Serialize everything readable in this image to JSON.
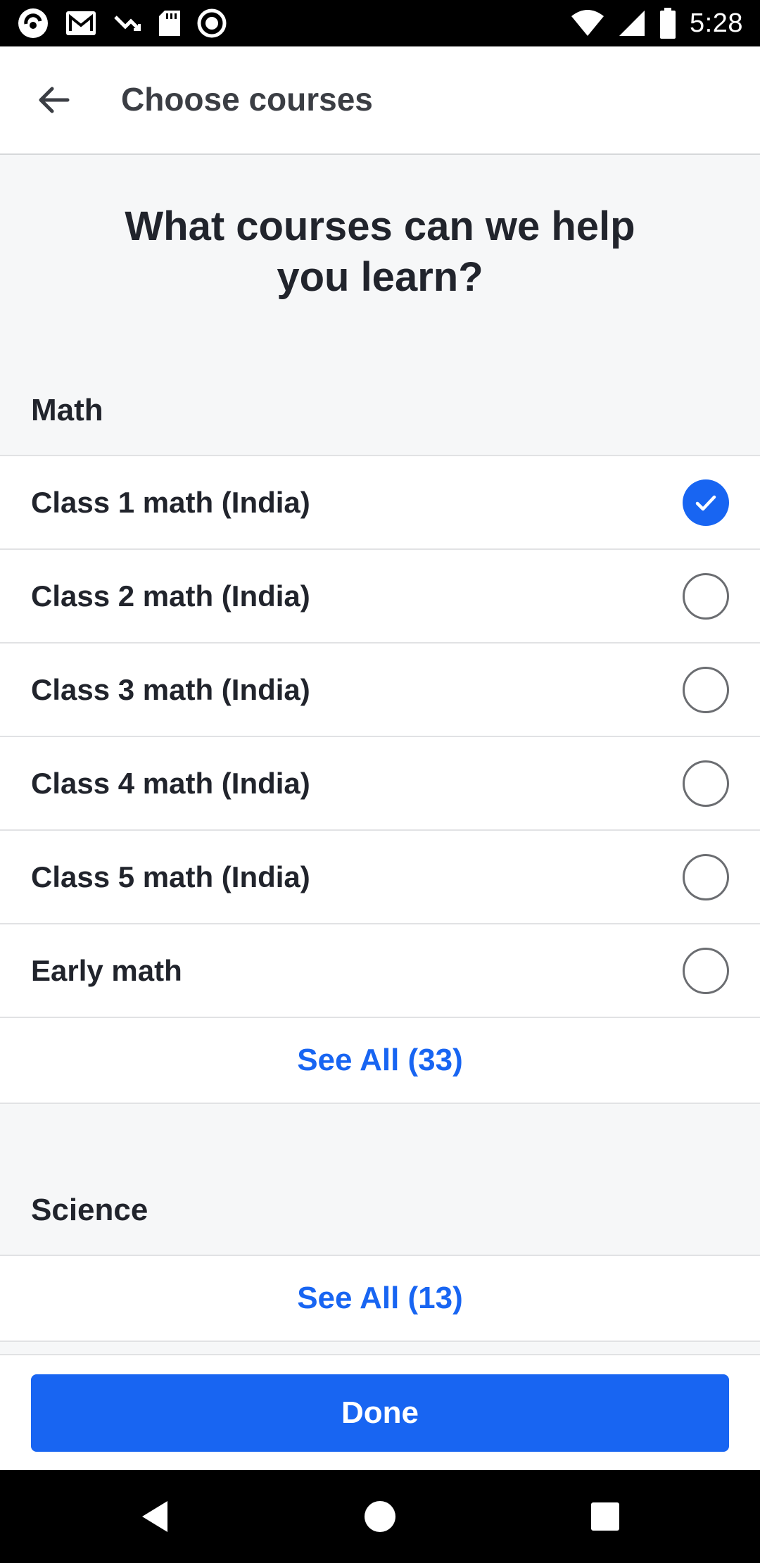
{
  "status_bar": {
    "time": "5:28",
    "left_icons": [
      "app-logo-icon",
      "gmail-icon",
      "missed-call-icon",
      "sd-card-icon",
      "record-icon"
    ],
    "right_icons": [
      "wifi-icon",
      "cell-signal-icon",
      "battery-icon"
    ]
  },
  "app_bar": {
    "back_icon": "arrow-left-icon",
    "title": "Choose courses"
  },
  "question": {
    "line1": "What courses can we help",
    "line2": "you learn?"
  },
  "sections": {
    "math": {
      "header": "Math",
      "items": [
        {
          "label": "Class 1 math (India)",
          "selected": true
        },
        {
          "label": "Class 2 math (India)",
          "selected": false
        },
        {
          "label": "Class 3 math (India)",
          "selected": false
        },
        {
          "label": "Class 4 math (India)",
          "selected": false
        },
        {
          "label": "Class 5 math (India)",
          "selected": false
        },
        {
          "label": "Early math",
          "selected": false
        }
      ],
      "see_all": "See All (33)"
    },
    "science": {
      "header": "Science",
      "see_all": "See All (13)"
    }
  },
  "footer": {
    "done_label": "Done"
  },
  "colors": {
    "accent": "#1865f2",
    "background": "#f6f7f8",
    "text": "#21242c"
  },
  "nav_bar": {
    "icons": [
      "back-triangle-icon",
      "home-circle-icon",
      "recents-square-icon"
    ]
  }
}
